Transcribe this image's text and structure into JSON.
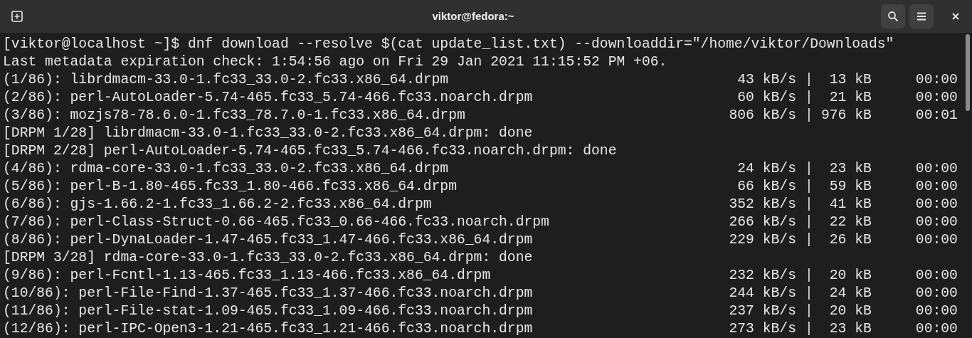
{
  "window": {
    "title": "viktor@fedora:~"
  },
  "lines": [
    {
      "kind": "text",
      "text": "[viktor@localhost ~]$ dnf download --resolve $(cat update_list.txt) --downloaddir=\"/home/viktor/Downloads\""
    },
    {
      "kind": "text",
      "text": "Last metadata expiration check: 1:54:56 ago on Fri 29 Jan 2021 11:15:52 PM +06."
    },
    {
      "kind": "download",
      "name": "(1/86): librdmacm-33.0-1.fc33_33.0-2.fc33.x86_64.drpm",
      "speed": "43 kB/s",
      "sep": "|",
      "size": "13 kB",
      "time": "00:00"
    },
    {
      "kind": "download",
      "name": "(2/86): perl-AutoLoader-5.74-465.fc33_5.74-466.fc33.noarch.drpm",
      "speed": "60 kB/s",
      "sep": "|",
      "size": "21 kB",
      "time": "00:00"
    },
    {
      "kind": "download",
      "name": "(3/86): mozjs78-78.6.0-1.fc33_78.7.0-1.fc33.x86_64.drpm",
      "speed": "806 kB/s",
      "sep": "|",
      "size": "976 kB",
      "time": "00:01"
    },
    {
      "kind": "text",
      "text": "[DRPM 1/28] librdmacm-33.0-1.fc33_33.0-2.fc33.x86_64.drpm: done"
    },
    {
      "kind": "text",
      "text": "[DRPM 2/28] perl-AutoLoader-5.74-465.fc33_5.74-466.fc33.noarch.drpm: done"
    },
    {
      "kind": "download",
      "name": "(4/86): rdma-core-33.0-1.fc33_33.0-2.fc33.x86_64.drpm",
      "speed": "24 kB/s",
      "sep": "|",
      "size": "23 kB",
      "time": "00:00"
    },
    {
      "kind": "download",
      "name": "(5/86): perl-B-1.80-465.fc33_1.80-466.fc33.x86_64.drpm",
      "speed": "66 kB/s",
      "sep": "|",
      "size": "59 kB",
      "time": "00:00"
    },
    {
      "kind": "download",
      "name": "(6/86): gjs-1.66.2-1.fc33_1.66.2-2.fc33.x86_64.drpm",
      "speed": "352 kB/s",
      "sep": "|",
      "size": "41 kB",
      "time": "00:00"
    },
    {
      "kind": "download",
      "name": "(7/86): perl-Class-Struct-0.66-465.fc33_0.66-466.fc33.noarch.drpm",
      "speed": "266 kB/s",
      "sep": "|",
      "size": "22 kB",
      "time": "00:00"
    },
    {
      "kind": "download",
      "name": "(8/86): perl-DynaLoader-1.47-465.fc33_1.47-466.fc33.x86_64.drpm",
      "speed": "229 kB/s",
      "sep": "|",
      "size": "26 kB",
      "time": "00:00"
    },
    {
      "kind": "text",
      "text": "[DRPM 3/28] rdma-core-33.0-1.fc33_33.0-2.fc33.x86_64.drpm: done"
    },
    {
      "kind": "download",
      "name": "(9/86): perl-Fcntl-1.13-465.fc33_1.13-466.fc33.x86_64.drpm",
      "speed": "232 kB/s",
      "sep": "|",
      "size": "20 kB",
      "time": "00:00"
    },
    {
      "kind": "download",
      "name": "(10/86): perl-File-Find-1.37-465.fc33_1.37-466.fc33.noarch.drpm",
      "speed": "244 kB/s",
      "sep": "|",
      "size": "24 kB",
      "time": "00:00"
    },
    {
      "kind": "download",
      "name": "(11/86): perl-File-stat-1.09-465.fc33_1.09-466.fc33.noarch.drpm",
      "speed": "237 kB/s",
      "sep": "|",
      "size": "20 kB",
      "time": "00:00"
    },
    {
      "kind": "download",
      "name": "(12/86): perl-IPC-Open3-1.21-465.fc33_1.21-466.fc33.noarch.drpm",
      "speed": "273 kB/s",
      "sep": "|",
      "size": "23 kB",
      "time": "00:00"
    }
  ]
}
